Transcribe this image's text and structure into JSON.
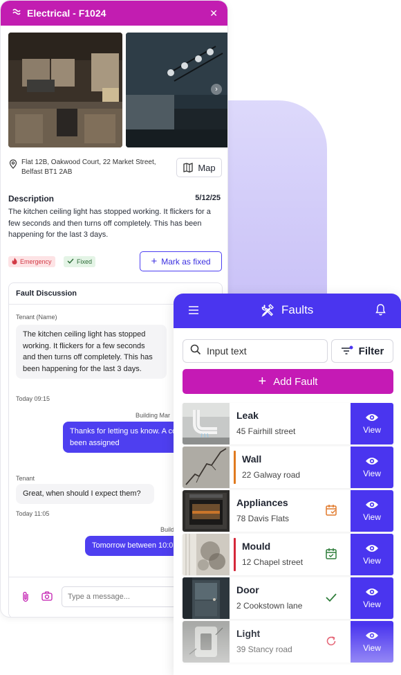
{
  "left": {
    "header_title": "Electrical - F1024",
    "address": "Flat 12B, Oakwood Court, 22 Market Street, Belfast BT1 2AB",
    "map_label": "Map",
    "description_title": "Description",
    "date": "5/12/25",
    "description": "The kitchen ceiling light has stopped working. It flickers for a few seconds and then turns off completely. This has been happening for the last 3 days.",
    "badges": {
      "emergency": "Emergency",
      "fixed": "Fixed"
    },
    "mark_fixed_label": "Mark as fixed",
    "discussion": {
      "title": "Fault Discussion",
      "messages": [
        {
          "author": "Tenant (Name)",
          "text": "The kitchen ceiling light has stopped working. It flickers for a few seconds and then turns off completely. This has been happening for the last 3 days.",
          "time": "Today 09:15"
        },
        {
          "author": "Building Mar",
          "text": "Thanks for letting us know. A contractor has been assigned"
        },
        {
          "author": "Tenant",
          "text": "Great, when should I expect them?",
          "time": "Today 11:05"
        },
        {
          "author": "Build",
          "text": "Tomorrow between 10:0"
        }
      ],
      "input_placeholder": "Type a message..."
    }
  },
  "right": {
    "header_title": "Faults",
    "search_value": "Input text",
    "filter_label": "Filter",
    "add_label": "Add Fault",
    "view_label": "View",
    "faults": [
      {
        "title": "Leak",
        "address": "45 Fairhill street"
      },
      {
        "title": "Wall",
        "address": "22 Galway road"
      },
      {
        "title": "Appliances",
        "address": "78 Davis Flats"
      },
      {
        "title": "Mould",
        "address": "12 Chapel street"
      },
      {
        "title": "Door",
        "address": "2 Cookstown lane"
      },
      {
        "title": "Light",
        "address": "39 Stancy road"
      }
    ]
  },
  "colors": {
    "magenta": "#c21db1",
    "indigo": "#4a35ef",
    "bar_orange": "#e07a1f",
    "bar_red": "#d5283a",
    "status_orange": "#e0782a",
    "status_green": "#2e7d3a",
    "status_red": "#e0475b"
  },
  "icons": [
    "electrical-icon",
    "close-icon",
    "chevron-right-icon",
    "location-pin-icon",
    "map-icon",
    "fire-icon",
    "check-icon",
    "plus-icon",
    "attach-icon",
    "camera-icon",
    "menu-icon",
    "tools-icon",
    "bell-icon",
    "search-icon",
    "filter-icon",
    "eye-icon",
    "calendar-x-icon",
    "calendar-check-icon",
    "refresh-icon"
  ]
}
